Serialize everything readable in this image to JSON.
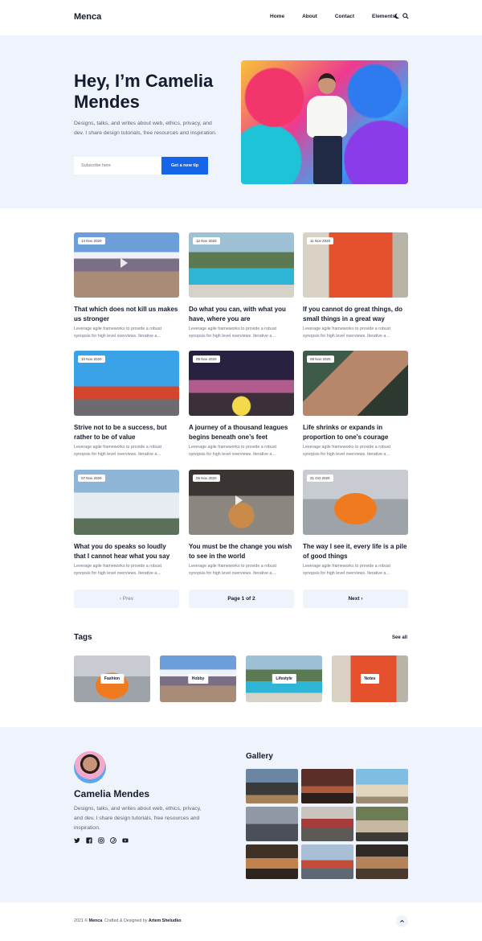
{
  "header": {
    "logo": "Menca",
    "nav": [
      "Home",
      "About",
      "Contact",
      "Elements"
    ]
  },
  "hero": {
    "title": "Hey, I’m Camelia Mendes",
    "description": "Designs, talks, and writes about web, ethics, privacy, and dev. I share design tutorials, free resources and inspiration.",
    "subscribe_placeholder": "Subscribe here",
    "button_label": "Get a new tip"
  },
  "posts": [
    {
      "date": "14 Nov 2020",
      "title": "That which does not kill us makes us stronger",
      "excerpt": "Leverage agile frameworks to provide a robust synopsis for high level overviews. Iterative a…"
    },
    {
      "date": "12 Nov 2020",
      "title": "Do what you can, with what you have, where you are",
      "excerpt": "Leverage agile frameworks to provide a robust synopsis for high level overviews. Iterative a…"
    },
    {
      "date": "11 Nov 2020",
      "title": "If you cannot do great things, do small things in a great way",
      "excerpt": "Leverage agile frameworks to provide a robust synopsis for high level overviews. Iterative a…"
    },
    {
      "date": "10 Nov 2020",
      "title": "Strive not to be a success, but rather to be of value",
      "excerpt": "Leverage agile frameworks to provide a robust synopsis for high level overviews. Iterative a…"
    },
    {
      "date": "09 Nov 2020",
      "title": "A journey of a thousand leagues begins beneath one’s feet",
      "excerpt": "Leverage agile frameworks to provide a robust synopsis for high level overviews. Iterative a…"
    },
    {
      "date": "08 Nov 2020",
      "title": "Life shrinks or expands in proportion to one’s courage",
      "excerpt": "Leverage agile frameworks to provide a robust synopsis for high level overviews. Iterative a…"
    },
    {
      "date": "07 Nov 2020",
      "title": "What you do speaks so loudly that I cannot hear what you say",
      "excerpt": "Leverage agile frameworks to provide a robust synopsis for high level overviews. Iterative a…"
    },
    {
      "date": "06 Nov 2020",
      "title": "You must be the change you wish to see in the world",
      "excerpt": "Leverage agile frameworks to provide a robust synopsis for high level overviews. Iterative a…"
    },
    {
      "date": "21 Oct 2020",
      "title": "The way I see it, every life is a pile of good things",
      "excerpt": "Leverage agile frameworks to provide a robust synopsis for high level overviews. Iterative a…"
    }
  ],
  "pagination": {
    "prev": "‹ Prev",
    "current": "Page 1 of 2",
    "next": "Next ›"
  },
  "tags": {
    "title": "Tags",
    "see_all": "See all",
    "items": [
      "Fashion",
      "Hobby",
      "Lifestyle",
      "Notes"
    ]
  },
  "about": {
    "name": "Camelia Mendes",
    "description": "Designs, talks, and writes about web, ethics, privacy, and dev. I share design tutorials, free resources and inspiration."
  },
  "gallery": {
    "title": "Gallery"
  },
  "footer": {
    "year": "2021 ©",
    "site": "Menca",
    "crafted": ". Crafted & Designed by",
    "author": "Artem Sheludko",
    "end": "."
  },
  "colors": {
    "accent": "#1665e8",
    "light_bg": "#eff4fc",
    "text": "#141b2d"
  }
}
